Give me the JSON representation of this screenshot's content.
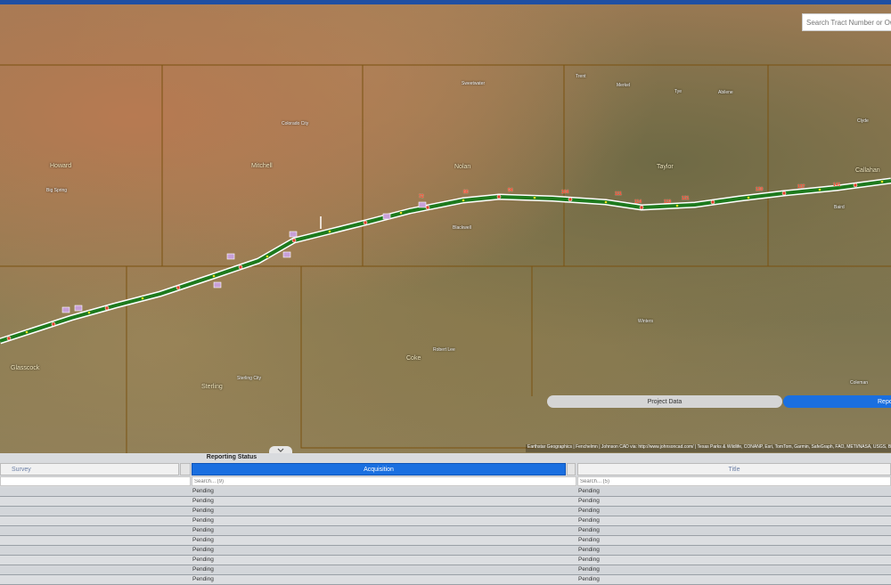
{
  "search": {
    "placeholder": "Search Tract Number or Owner"
  },
  "counties": [
    "Howard",
    "Mitchell",
    "Nolan",
    "Taylor",
    "Callahan",
    "Glasscock",
    "Sterling",
    "Coke"
  ],
  "towns": [
    "Big Spring",
    "Colorado City",
    "Sweetwater",
    "Abilene",
    "Merkel",
    "Tye",
    "Baird",
    "Trent",
    "Clyde",
    "Blackwell",
    "Robert Lee",
    "Sterling City",
    "Winters",
    "Coleman"
  ],
  "route_labels": [
    "72",
    "80",
    "94",
    "104",
    "111",
    "114",
    "119",
    "121",
    "130",
    "137",
    "141"
  ],
  "toggle": {
    "project_data": "Project Data",
    "reporting": "Repo"
  },
  "attribution": "Earthstar Geographics | Fenchelmn | Johnson CAD via: http://www.johnsoncad.com/ | Texas Parks & Wildlife, CONANP, Esri, TomTom, Garmin, SafeGraph, FAO, METI/NASA, USGS, Bureau of Land Management, EPA, NPS, USFWS",
  "panel": {
    "title": "Reporting Status",
    "columns": {
      "survey": "Survey",
      "acquisition": "Acquisition",
      "title": "Title"
    },
    "filters": {
      "survey": "",
      "acquisition": "Search... (9)",
      "title": "Search... (5)"
    },
    "rows": [
      {
        "survey": "",
        "acquisition": "Pending",
        "title": "Pending"
      },
      {
        "survey": "",
        "acquisition": "Pending",
        "title": "Pending"
      },
      {
        "survey": "",
        "acquisition": "Pending",
        "title": "Pending"
      },
      {
        "survey": "",
        "acquisition": "Pending",
        "title": "Pending"
      },
      {
        "survey": "",
        "acquisition": "Pending",
        "title": "Pending"
      },
      {
        "survey": "",
        "acquisition": "Pending",
        "title": "Pending"
      },
      {
        "survey": "",
        "acquisition": "Pending",
        "title": "Pending"
      },
      {
        "survey": "",
        "acquisition": "Pending",
        "title": "Pending"
      },
      {
        "survey": "",
        "acquisition": "Pending",
        "title": "Pending"
      },
      {
        "survey": "",
        "acquisition": "Pending",
        "title": "Pending"
      }
    ]
  },
  "colors": {
    "accent": "#1a6fe0",
    "topbar": "#1f4fa3",
    "route": "#1e7a1e",
    "marker": "#e0402a"
  }
}
